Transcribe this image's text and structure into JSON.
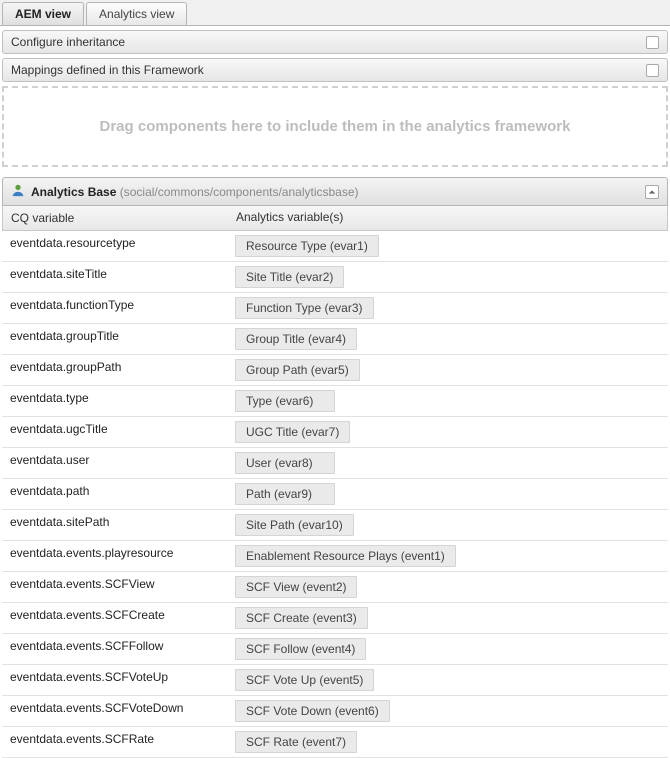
{
  "tabs": [
    {
      "label": "AEM view",
      "active": true
    },
    {
      "label": "Analytics view",
      "active": false
    }
  ],
  "sections": {
    "inheritance_label": "Configure inheritance",
    "mappings_label": "Mappings defined in this Framework"
  },
  "dropzone": {
    "text": "Drag components here to include them in the analytics framework"
  },
  "panel": {
    "title": "Analytics Base",
    "path": "(social/commons/components/analyticsbase)"
  },
  "table": {
    "header_cq": "CQ variable",
    "header_analytics": "Analytics variable(s)",
    "rows": [
      {
        "cq": "eventdata.resourcetype",
        "analytics": "Resource Type (evar1)"
      },
      {
        "cq": "eventdata.siteTitle",
        "analytics": "Site Title (evar2)"
      },
      {
        "cq": "eventdata.functionType",
        "analytics": "Function Type (evar3)"
      },
      {
        "cq": "eventdata.groupTitle",
        "analytics": "Group Title (evar4)"
      },
      {
        "cq": "eventdata.groupPath",
        "analytics": "Group Path (evar5)"
      },
      {
        "cq": "eventdata.type",
        "analytics": "Type (evar6)"
      },
      {
        "cq": "eventdata.ugcTitle",
        "analytics": "UGC Title (evar7)"
      },
      {
        "cq": "eventdata.user",
        "analytics": "User (evar8)"
      },
      {
        "cq": "eventdata.path",
        "analytics": "Path (evar9)"
      },
      {
        "cq": "eventdata.sitePath",
        "analytics": "Site Path (evar10)"
      },
      {
        "cq": "eventdata.events.playresource",
        "analytics": "Enablement Resource Plays (event1)"
      },
      {
        "cq": "eventdata.events.SCFView",
        "analytics": "SCF View (event2)"
      },
      {
        "cq": "eventdata.events.SCFCreate",
        "analytics": "SCF Create (event3)"
      },
      {
        "cq": "eventdata.events.SCFFollow",
        "analytics": "SCF Follow (event4)"
      },
      {
        "cq": "eventdata.events.SCFVoteUp",
        "analytics": "SCF Vote Up (event5)"
      },
      {
        "cq": "eventdata.events.SCFVoteDown",
        "analytics": "SCF Vote Down (event6)"
      },
      {
        "cq": "eventdata.events.SCFRate",
        "analytics": "SCF Rate (event7)"
      }
    ]
  }
}
